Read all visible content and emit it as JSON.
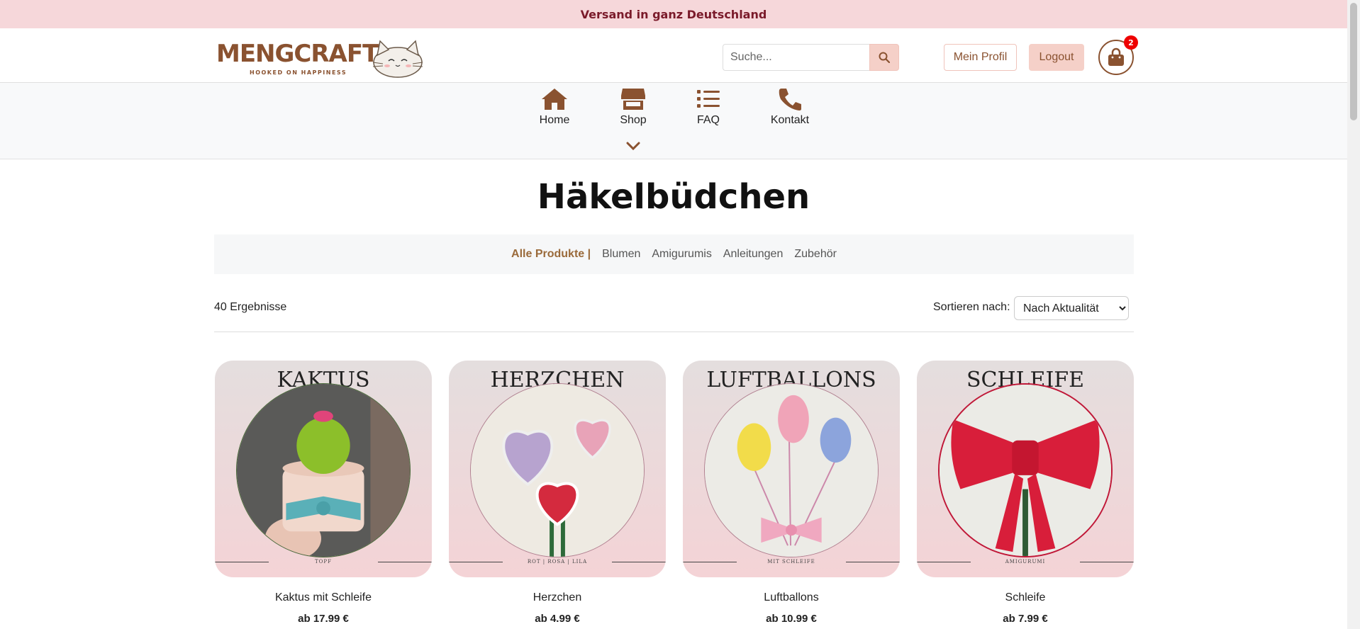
{
  "banner": {
    "text": "Versand in ganz Deutschland"
  },
  "logo": {
    "name": "MENGCRAFT",
    "tagline": "HOOKED ON HAPPINESS"
  },
  "search": {
    "placeholder": "Suche..."
  },
  "header": {
    "profile_label": "Mein Profil",
    "logout_label": "Logout",
    "cart_count": "2"
  },
  "nav": {
    "items": [
      {
        "label": "Home",
        "icon": "home-icon"
      },
      {
        "label": "Shop",
        "icon": "shop-icon"
      },
      {
        "label": "FAQ",
        "icon": "list-icon"
      },
      {
        "label": "Kontakt",
        "icon": "phone-icon"
      }
    ]
  },
  "page": {
    "title": "Häkelbüdchen"
  },
  "categories": {
    "active": "Alle Produkte |",
    "items": [
      "Blumen",
      "Amigurumis",
      "Anleitungen",
      "Zubehör"
    ]
  },
  "listing": {
    "results": "40 Ergebnisse",
    "sort_label": "Sortieren nach:",
    "sort_value": "Nach Aktualität"
  },
  "products": [
    {
      "heading": "KAKTUS",
      "subtitle": "TOPF",
      "name": "Kaktus mit Schleife",
      "price": "ab 17.99 €"
    },
    {
      "heading": "HERZCHEN",
      "subtitle": "ROT | ROSA | LILA",
      "name": "Herzchen",
      "price": "ab 4.99 €"
    },
    {
      "heading": "LUFTBALLONS",
      "subtitle": "MIT SCHLEIFE",
      "name": "Luftballons",
      "price": "ab 10.99 €"
    },
    {
      "heading": "SCHLEIFE",
      "subtitle": "AMIGURUMI",
      "name": "Schleife",
      "price": "ab 7.99 €"
    }
  ],
  "colors": {
    "brand": "#8a5230",
    "banner": "#f6d7da",
    "accent": "#f5d0c8",
    "badge": "#ee0000"
  }
}
